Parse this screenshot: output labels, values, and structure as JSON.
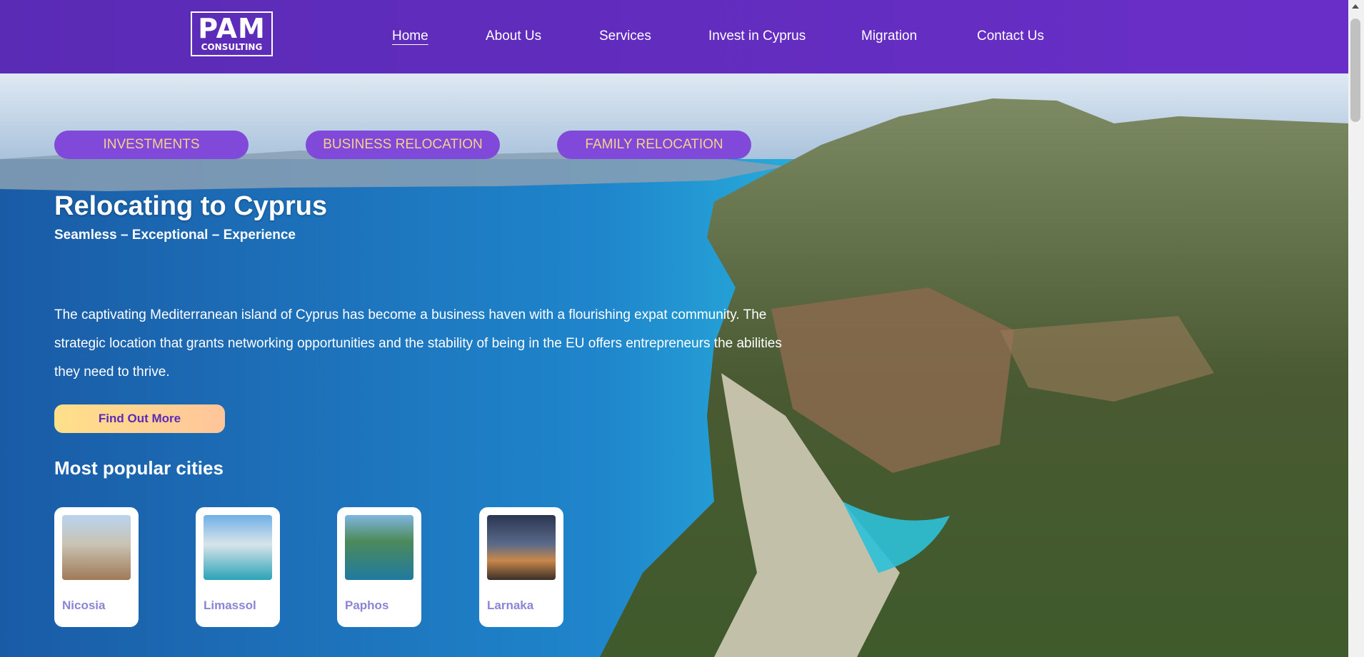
{
  "header": {
    "logo": {
      "line1": "PAM",
      "line2": "CONSULTING"
    },
    "nav": [
      {
        "label": "Home",
        "active": true
      },
      {
        "label": "About Us",
        "active": false
      },
      {
        "label": "Services",
        "active": false
      },
      {
        "label": "Invest in Cyprus",
        "active": false
      },
      {
        "label": "Migration",
        "active": false
      },
      {
        "label": "Contact Us",
        "active": false
      }
    ]
  },
  "hero": {
    "pills": [
      "INVESTMENTS",
      "BUSINESS RELOCATION",
      "FAMILY RELOCATION"
    ],
    "title": "Relocating to Cyprus",
    "subtitle": "Seamless – Exceptional – Experience",
    "description": "The captivating Mediterranean island of Cyprus has become a business haven with a flourishing expat community. The strategic location that grants networking opportunities and the stability of being in the EU offers entrepreneurs the abilities they need to thrive.",
    "cta_label": "Find Out More"
  },
  "cities": {
    "heading": "Most popular cities",
    "items": [
      {
        "name": "Nicosia",
        "image": "nicosia-city-photo"
      },
      {
        "name": "Limassol",
        "image": "limassol-coast-photo"
      },
      {
        "name": "Paphos",
        "image": "paphos-harbour-photo"
      },
      {
        "name": "Larnaka",
        "image": "larnaka-promenade-photo"
      }
    ]
  },
  "colors": {
    "header_bg": "#5a2bb5",
    "pill_bg": "#8149d9",
    "pill_text": "#f5d08a",
    "cta_bg": "#ffd48f",
    "city_name": "#8a84d6"
  }
}
